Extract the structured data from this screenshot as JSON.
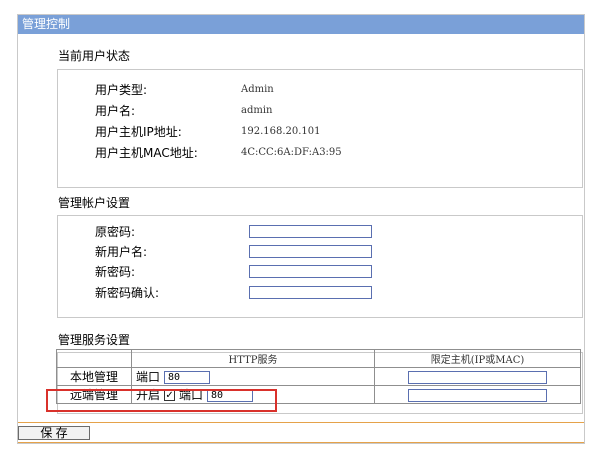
{
  "panel_title": "管理控制",
  "status": {
    "title": "当前用户状态",
    "rows": [
      {
        "label": "用户类型:",
        "value": "Admin"
      },
      {
        "label": "用户名:",
        "value": "admin"
      },
      {
        "label": "用户主机IP地址:",
        "value": "192.168.20.101"
      },
      {
        "label": "用户主机MAC地址:",
        "value": "4C:CC:6A:DF:A3:95"
      }
    ]
  },
  "account": {
    "title": "管理帐户设置",
    "fields": [
      {
        "label": "原密码:",
        "value": ""
      },
      {
        "label": "新用户名:",
        "value": ""
      },
      {
        "label": "新密码:",
        "value": ""
      },
      {
        "label": "新密码确认:",
        "value": ""
      }
    ]
  },
  "service": {
    "title": "管理服务设置",
    "headers": [
      "HTTP服务",
      "限定主机(IP或MAC)"
    ],
    "local": {
      "label": "本地管理",
      "port_label": "端口",
      "port_value": "80",
      "host_value": ""
    },
    "remote": {
      "label": "远端管理",
      "enable_label": "开启",
      "enabled": true,
      "check_glyph": "✓",
      "port_label": "端口",
      "port_value": "80",
      "host_value": ""
    }
  },
  "save_label": "保 存",
  "colors": {
    "title_bar": "#7aa0d8",
    "highlight": "#d9312b",
    "bottom_rule": "#e5a24a"
  }
}
